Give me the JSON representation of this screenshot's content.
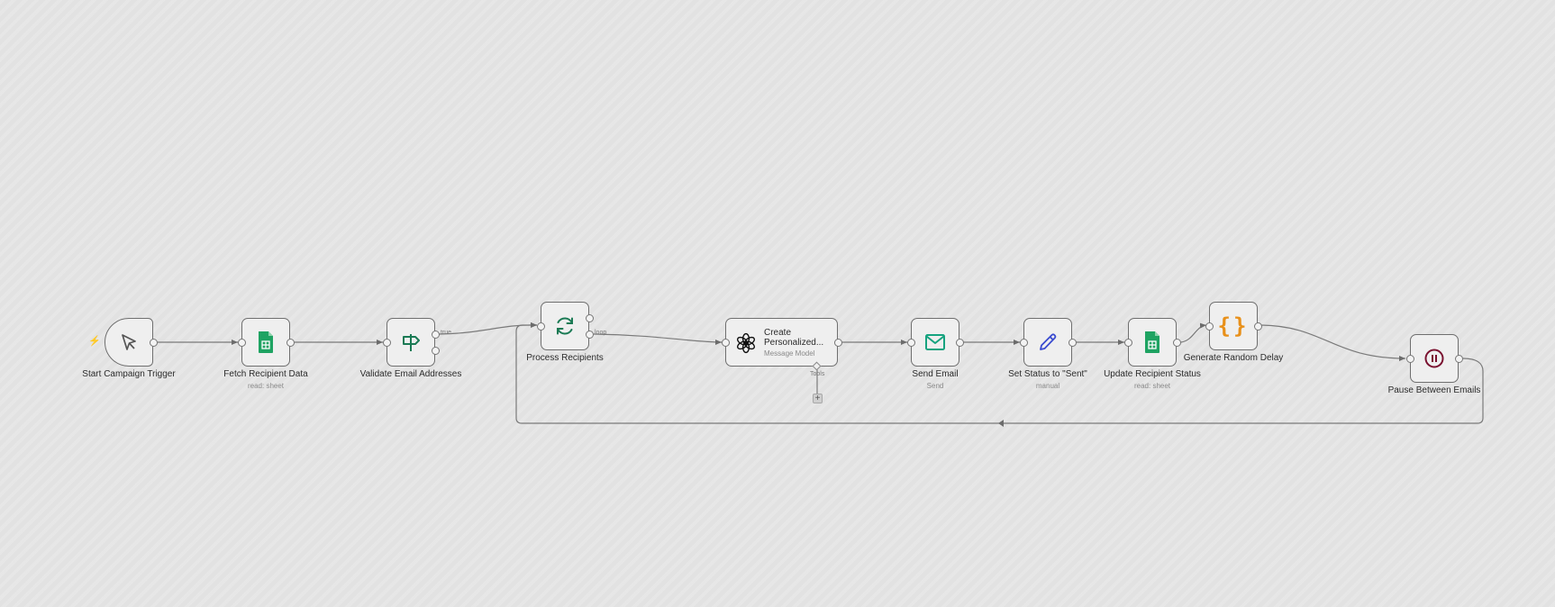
{
  "workflow": {
    "trigger_icon": "lightning-bolt-icon",
    "nodes": [
      {
        "id": "start",
        "label": "Start Campaign Trigger",
        "subtitle": "",
        "icon": "cursor-click-icon"
      },
      {
        "id": "fetch",
        "label": "Fetch Recipient Data",
        "subtitle": "read: sheet",
        "icon": "google-sheets-icon"
      },
      {
        "id": "validate",
        "label": "Validate Email Addresses",
        "subtitle": "",
        "icon": "signpost-icon"
      },
      {
        "id": "process",
        "label": "Process Recipients",
        "subtitle": "",
        "icon": "refresh-loop-icon"
      },
      {
        "id": "create",
        "label": "Create Personalized...",
        "subtitle": "Message Model",
        "icon": "openai-icon"
      },
      {
        "id": "send",
        "label": "Send Email",
        "subtitle": "Send",
        "icon": "envelope-icon"
      },
      {
        "id": "setstatus",
        "label": "Set Status to \"Sent\"",
        "subtitle": "manual",
        "icon": "pencil-icon"
      },
      {
        "id": "update",
        "label": "Update Recipient Status",
        "subtitle": "read: sheet",
        "icon": "google-sheets-icon"
      },
      {
        "id": "delay",
        "label": "Generate Random Delay",
        "subtitle": "",
        "icon": "curly-braces-icon"
      },
      {
        "id": "pause",
        "label": "Pause Between Emails",
        "subtitle": "",
        "icon": "pause-icon"
      }
    ],
    "edge_labels": {
      "true_branch": "true",
      "loop_branch": "loop",
      "tools": "Tools"
    },
    "tools_add": "+",
    "colors": {
      "sheets": "#1ea362",
      "loop": "#1a7a54",
      "signpost": "#1a7a54",
      "email": "#16a37f",
      "pencil": "#3a4bd0",
      "code": "#e8901a",
      "pause": "#7a1230",
      "bolt": "#e06a4a"
    }
  }
}
